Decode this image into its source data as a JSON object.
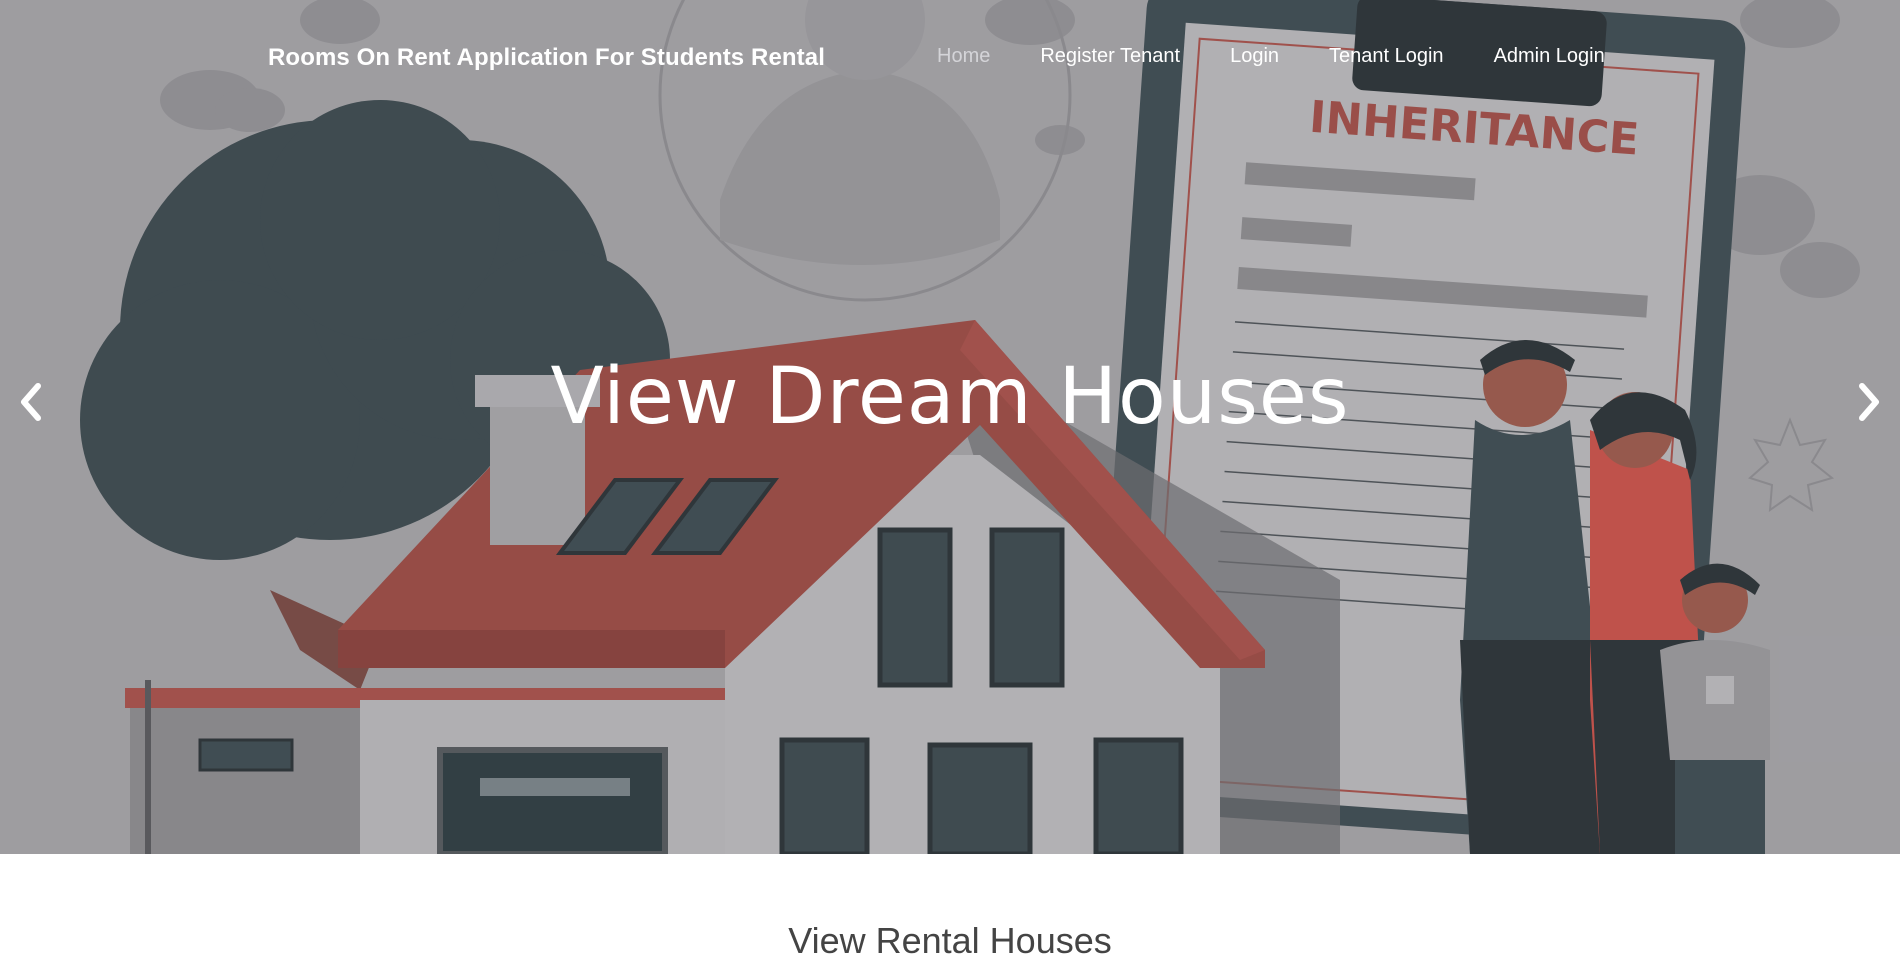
{
  "navbar": {
    "brand": "Rooms On Rent Application For Students Rental",
    "links": [
      "Home",
      "Register Tenant",
      "Login",
      "Tenant Login",
      "Admin Login"
    ],
    "active_index": 0
  },
  "hero": {
    "caption": "View Dream Houses",
    "illustration_text": "INHERITANCE",
    "prev_icon": "chevron-left-icon",
    "next_icon": "chevron-right-icon",
    "colors": {
      "background": "#a4a3a7",
      "dark": "#2f3d43",
      "roof": "#9c4b45",
      "accent": "#c8524a"
    }
  },
  "main": {
    "section_title": "View Rental Houses"
  }
}
